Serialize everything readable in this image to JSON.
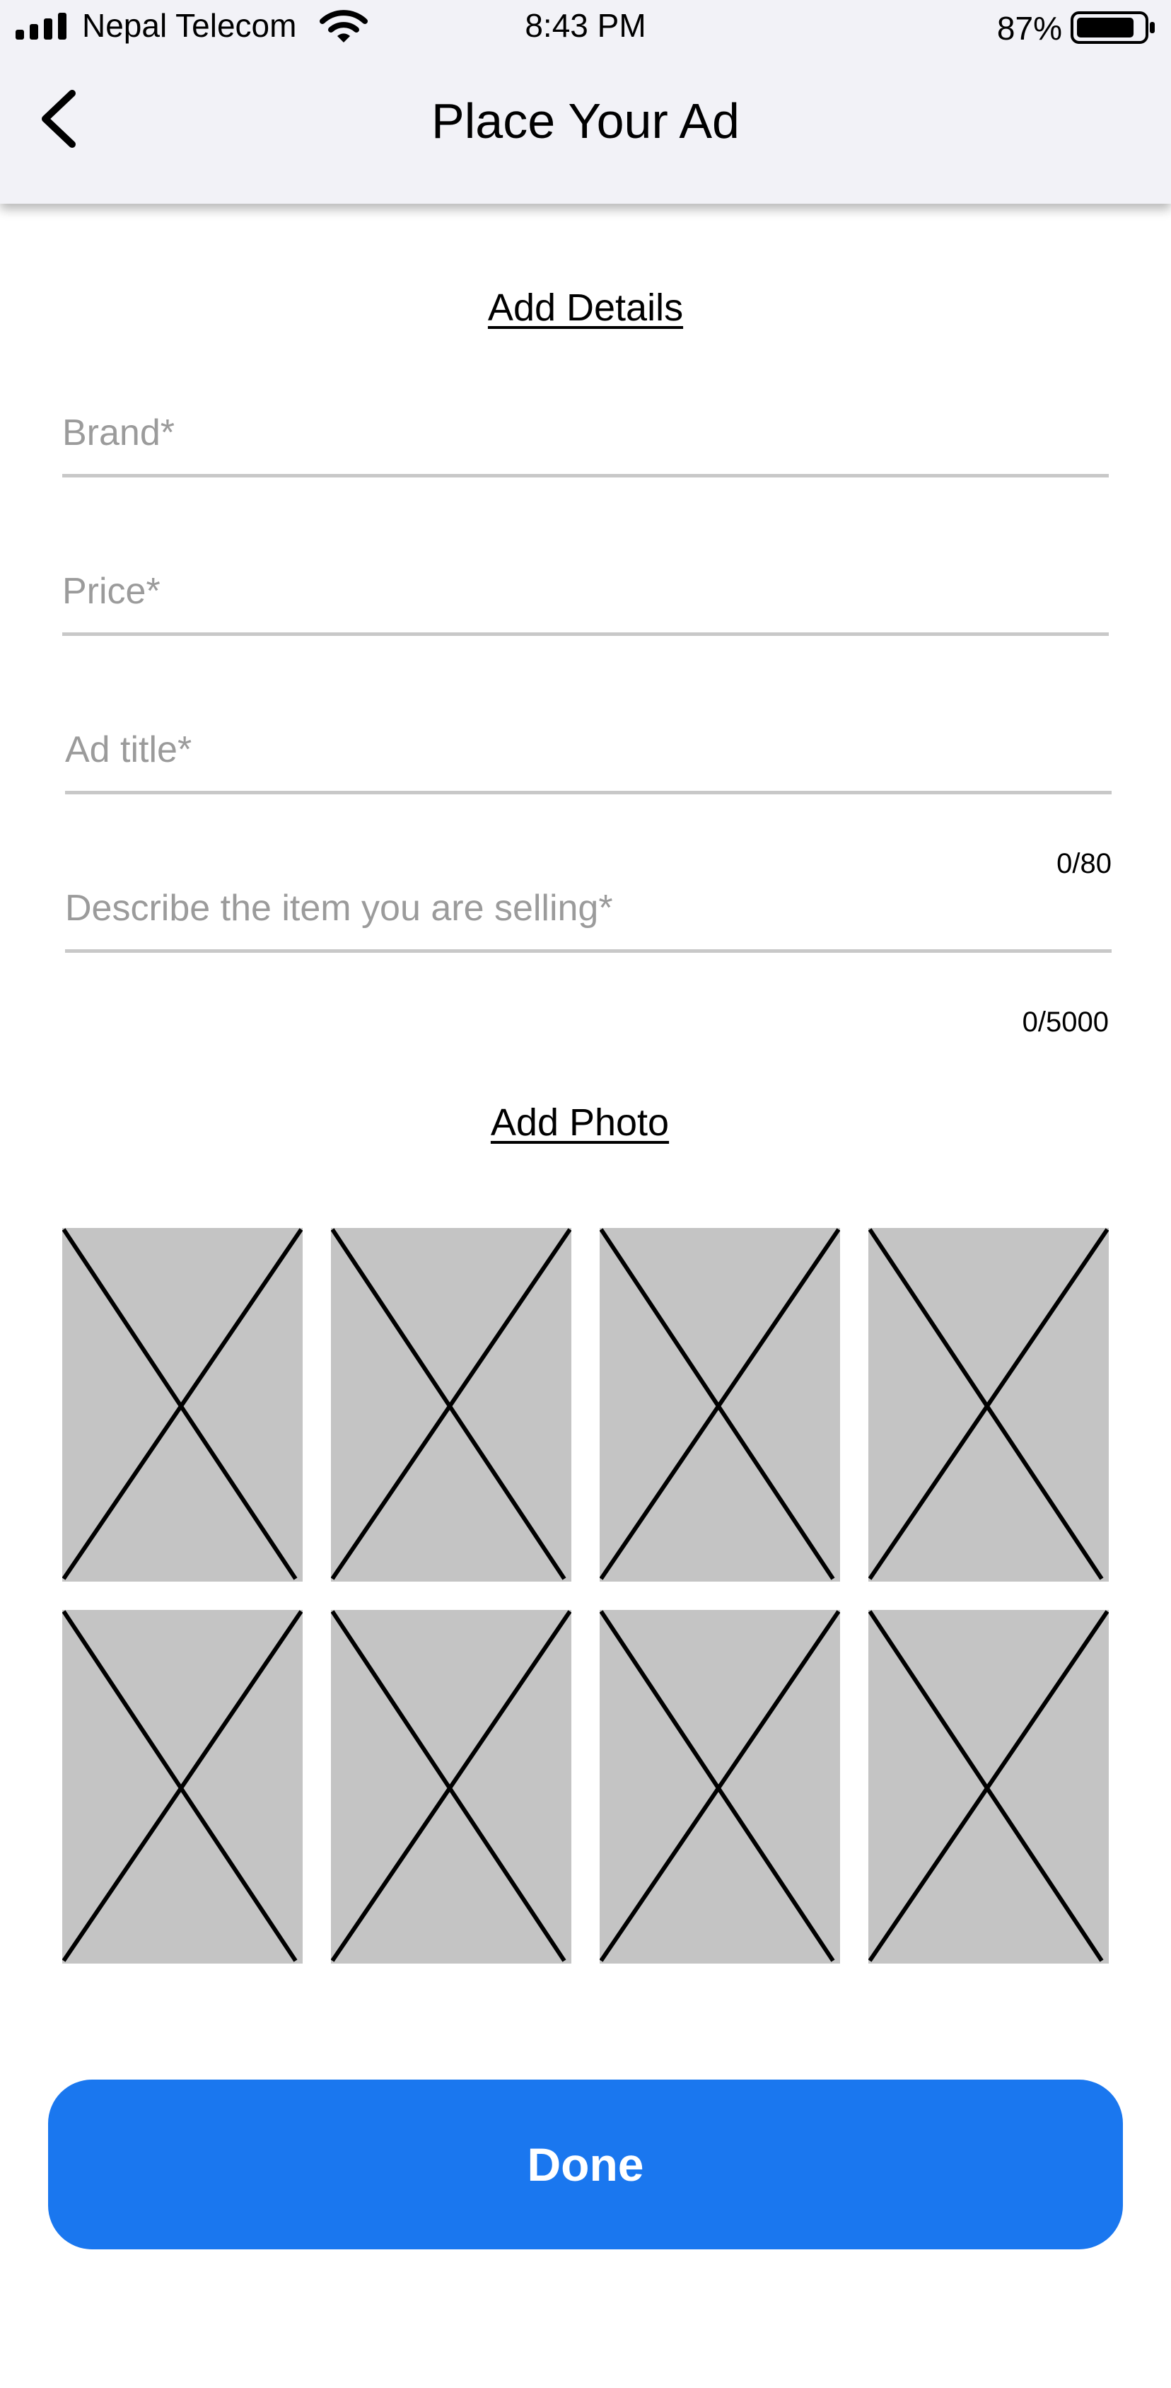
{
  "status_bar": {
    "carrier": "Nepal Telecom",
    "time": "8:43 PM",
    "battery_percent": "87%",
    "battery_level": 0.87,
    "signal_icon": "signal-bars-icon",
    "wifi_icon": "wifi-icon",
    "battery_icon": "battery-icon"
  },
  "nav": {
    "title": "Place Your Ad",
    "back_icon": "chevron-left-icon"
  },
  "details": {
    "heading": "Add Details",
    "fields": [
      {
        "name": "brand",
        "placeholder": "Brand*",
        "value": ""
      },
      {
        "name": "price",
        "placeholder": "Price*",
        "value": ""
      },
      {
        "name": "ad_title",
        "placeholder": "Ad title*",
        "value": "",
        "counter": "0/80"
      },
      {
        "name": "description",
        "placeholder": "Describe the item you are selling*",
        "value": "",
        "counter": "0/5000"
      }
    ]
  },
  "photos": {
    "heading": "Add Photo",
    "slots": [
      {
        "icon": "image-placeholder-icon"
      },
      {
        "icon": "image-placeholder-icon"
      },
      {
        "icon": "image-placeholder-icon"
      },
      {
        "icon": "image-placeholder-icon"
      },
      {
        "icon": "image-placeholder-icon"
      },
      {
        "icon": "image-placeholder-icon"
      },
      {
        "icon": "image-placeholder-icon"
      },
      {
        "icon": "image-placeholder-icon"
      }
    ]
  },
  "actions": {
    "done_label": "Done"
  },
  "colors": {
    "primary": "#1a77ef",
    "header_background": "#f2f2f7",
    "placeholder_tile": "#c4c4c4",
    "field_underline": "#c8c8c8",
    "placeholder_text": "#9b9b9b"
  }
}
